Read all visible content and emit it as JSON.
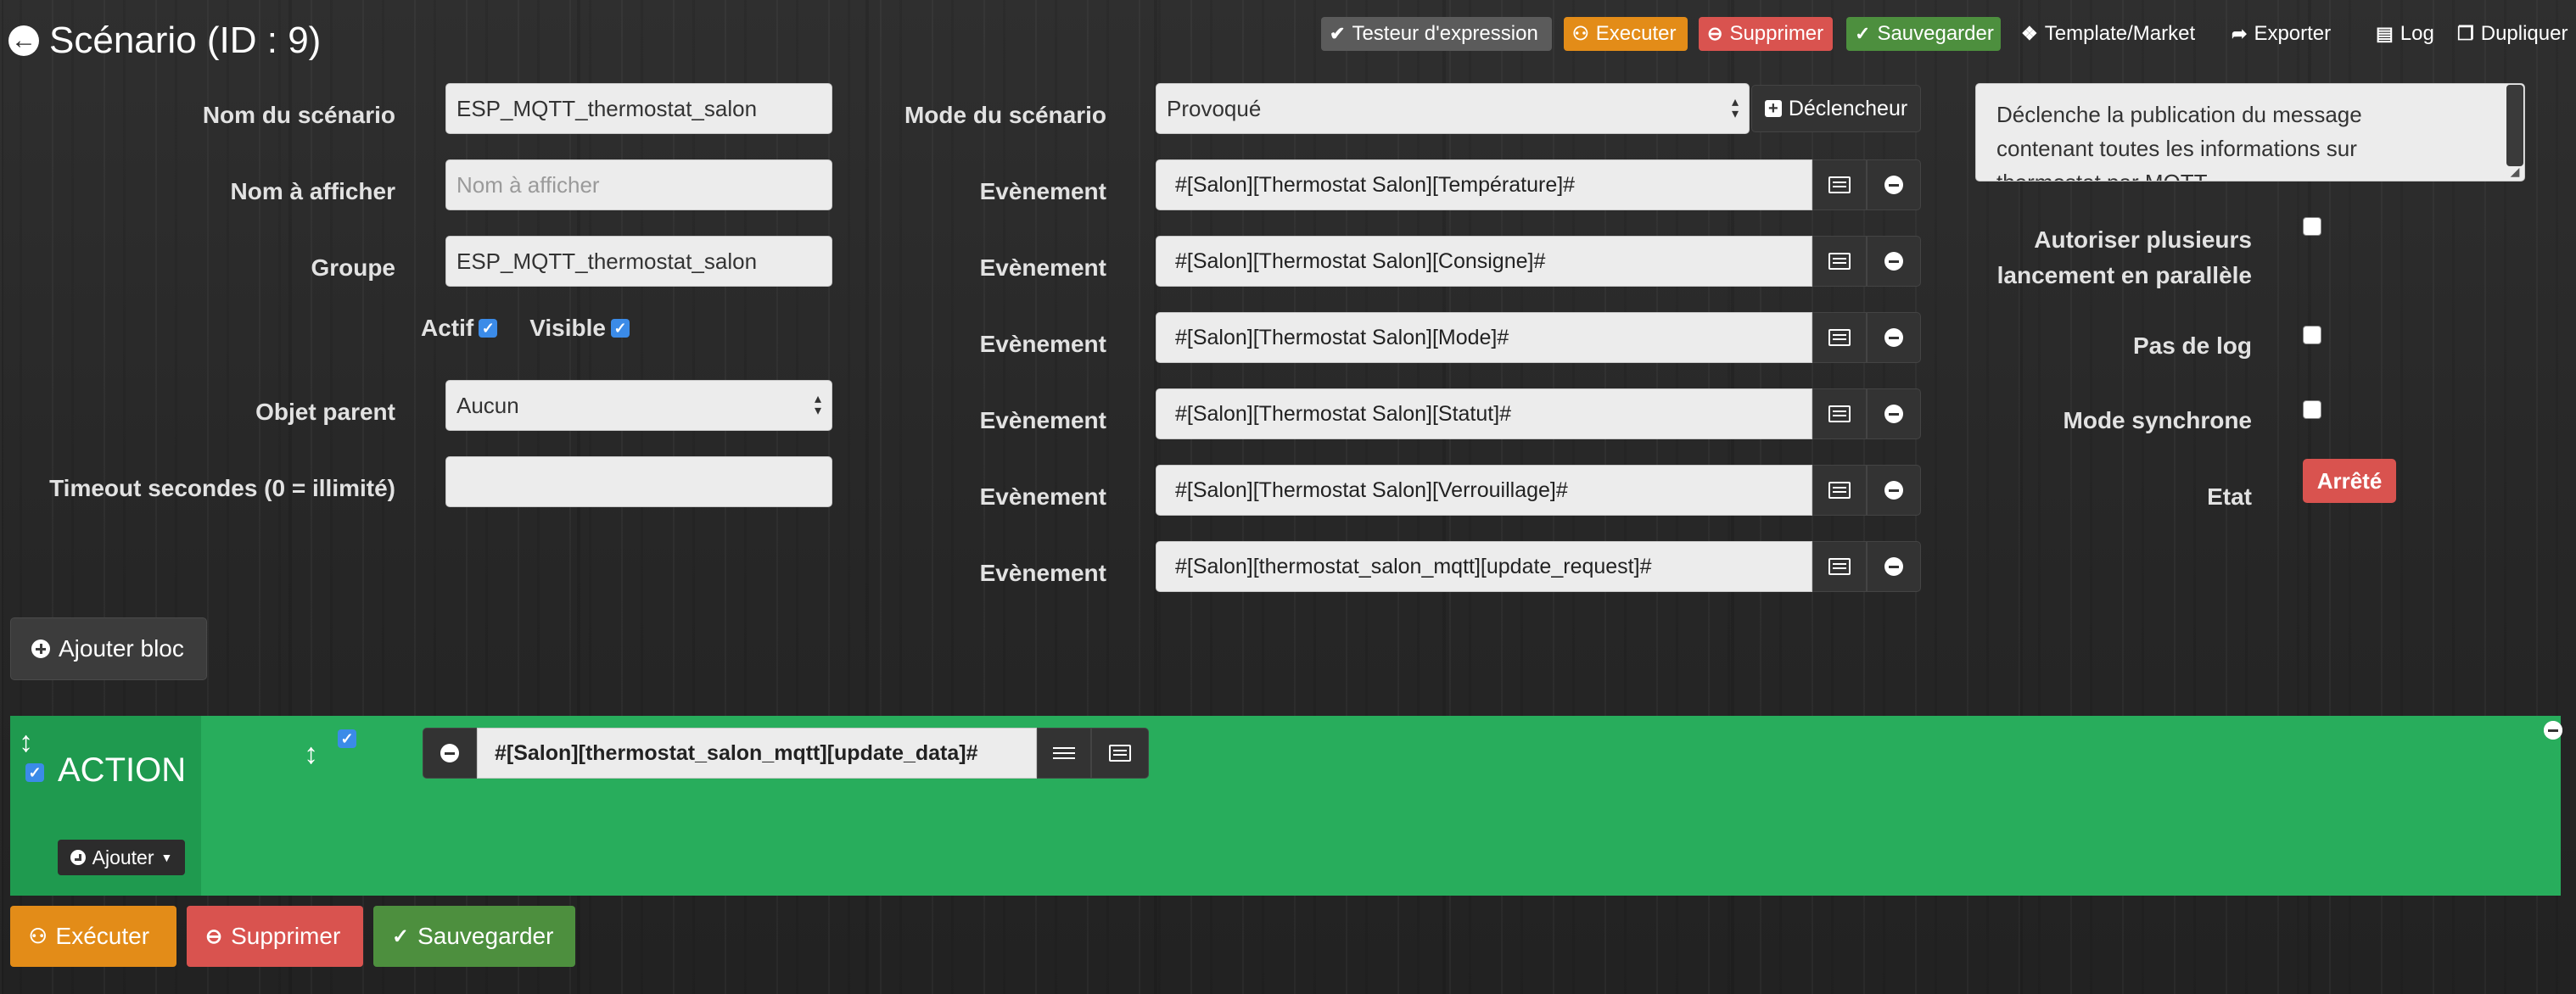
{
  "header": {
    "title": "Scénario (ID : 9)",
    "buttons": {
      "tester": "Testeur d'expression",
      "execute": "Executer",
      "delete": "Supprimer",
      "save": "Sauvegarder",
      "template": "Template/Market",
      "export": "Exporter",
      "log": "Log",
      "duplicate": "Dupliquer"
    }
  },
  "general": {
    "name_label": "Nom du scénario",
    "name_value": "ESP_MQTT_thermostat_salon",
    "display_label": "Nom à afficher",
    "display_placeholder": "Nom à afficher",
    "group_label": "Groupe",
    "group_value": "ESP_MQTT_thermostat_salon",
    "active_label": "Actif",
    "visible_label": "Visible",
    "parent_label": "Objet parent",
    "parent_value": "Aucun",
    "timeout_label": "Timeout secondes (0 = illimité)",
    "timeout_value": ""
  },
  "mode": {
    "label": "Mode du scénario",
    "value": "Provoqué",
    "trigger_button": "Déclencheur"
  },
  "events": {
    "label": "Evènement",
    "items": [
      "#[Salon][Thermostat Salon][Température]#",
      "#[Salon][Thermostat Salon][Consigne]#",
      "#[Salon][Thermostat Salon][Mode]#",
      "#[Salon][Thermostat Salon][Statut]#",
      "#[Salon][Thermostat Salon][Verrouillage]#",
      "#[Salon][thermostat_salon_mqtt][update_request]#"
    ]
  },
  "right": {
    "description_line1": "Déclenche la publication du message",
    "description_line2": "contenant toutes les informations sur",
    "description_line3": "thermostat par MQTT",
    "parallel_label_line1": "Autoriser plusieurs",
    "parallel_label_line2": "lancement en parallèle",
    "nolog_label": "Pas de log",
    "sync_label": "Mode synchrone",
    "state_label": "Etat",
    "state_value": "Arrêté"
  },
  "add_block": "Ajouter bloc",
  "action_block": {
    "title": "ACTION",
    "add_button": "Ajouter",
    "command": "#[Salon][thermostat_salon_mqtt][update_data]#"
  },
  "footer": {
    "execute": "Exécuter",
    "delete": "Supprimer",
    "save": "Sauvegarder"
  },
  "colors": {
    "orange": "#e38c18",
    "red": "#d9534f",
    "green": "#4d8f3e",
    "action_green": "#28ad5c",
    "checkbox_blue": "#3b8be8"
  }
}
